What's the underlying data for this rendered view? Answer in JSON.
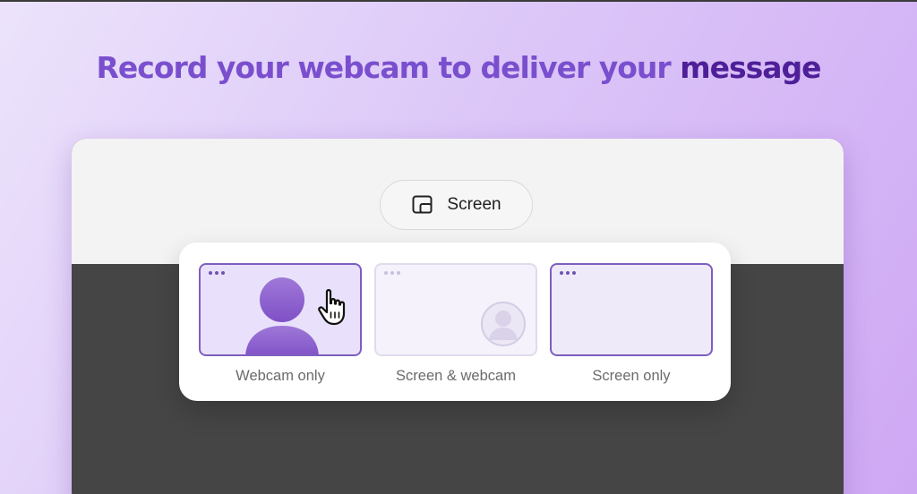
{
  "headline": {
    "main": "Record your webcam to deliver your",
    "emphasis": "message"
  },
  "toolbar": {
    "screen_label": "Screen",
    "screen_icon": "screen-share-icon"
  },
  "modes": {
    "options": [
      {
        "label": "Webcam only",
        "selected": true
      },
      {
        "label": "Screen & webcam",
        "selected": false
      },
      {
        "label": "Screen only",
        "selected": false
      }
    ]
  },
  "colors": {
    "headline": "#7a4fce",
    "headline_emphasis": "#4e1f98",
    "accent": "#7d5ec0",
    "person": "#8e62cf",
    "dark_area": "#454545"
  }
}
